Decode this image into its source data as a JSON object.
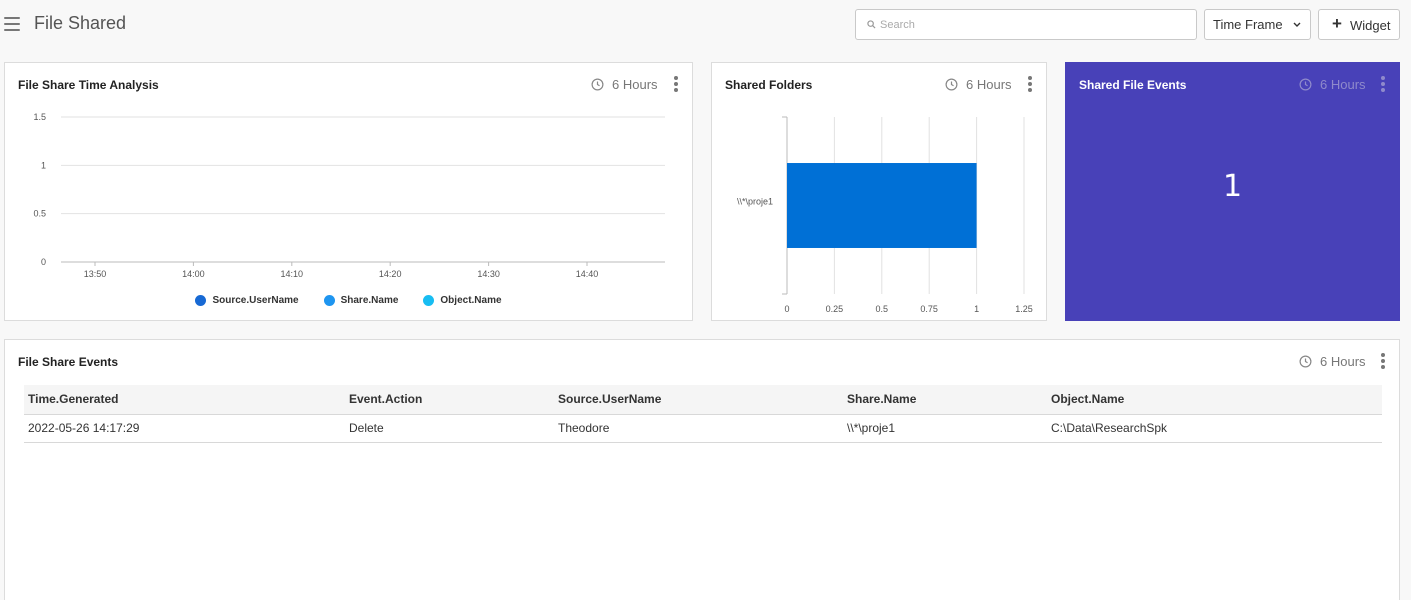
{
  "header": {
    "title": "File Shared",
    "search_placeholder": "Search",
    "timeframe_label": "Time Frame",
    "widget_label": "Widget"
  },
  "widgets": {
    "time_analysis": {
      "title": "File Share Time Analysis",
      "time_range": "6 Hours"
    },
    "shared_folders": {
      "title": "Shared Folders",
      "time_range": "6 Hours"
    },
    "shared_file_events": {
      "title": "Shared File Events",
      "time_range": "6 Hours",
      "value": "1",
      "accent_color": "#4841b8"
    },
    "file_share_events": {
      "title": "File Share Events",
      "time_range": "6 Hours"
    }
  },
  "chart_data": [
    {
      "type": "line",
      "title": "File Share Time Analysis",
      "x": [
        "13:50",
        "14:00",
        "14:10",
        "14:20",
        "14:30",
        "14:40"
      ],
      "ylim": [
        0,
        1.5
      ],
      "yticks": [
        "1.5",
        "1",
        "0.5",
        "0"
      ],
      "grid": true,
      "legend_position": "bottom",
      "series": [
        {
          "name": "Source.UserName",
          "color": "#1769d4",
          "values": []
        },
        {
          "name": "Share.Name",
          "color": "#1e95f0",
          "values": []
        },
        {
          "name": "Object.Name",
          "color": "#17bdf2",
          "values": []
        }
      ]
    },
    {
      "type": "bar",
      "orientation": "horizontal",
      "title": "Shared Folders",
      "categories": [
        "\\\\*\\proje1"
      ],
      "values": [
        1
      ],
      "xlim": [
        0,
        1.25
      ],
      "xticks": [
        "0",
        "0.25",
        "0.5",
        "0.75",
        "1",
        "1.25"
      ],
      "grid": true,
      "bar_color": "#0070d6"
    }
  ],
  "table": {
    "columns": [
      "Time.Generated",
      "Event.Action",
      "Source.UserName",
      "Share.Name",
      "Object.Name"
    ],
    "rows": [
      [
        "2022-05-26 14:17:29",
        "Delete",
        "Theodore",
        "\\\\*\\proje1",
        "C:\\Data\\ResearchSpk"
      ]
    ]
  }
}
